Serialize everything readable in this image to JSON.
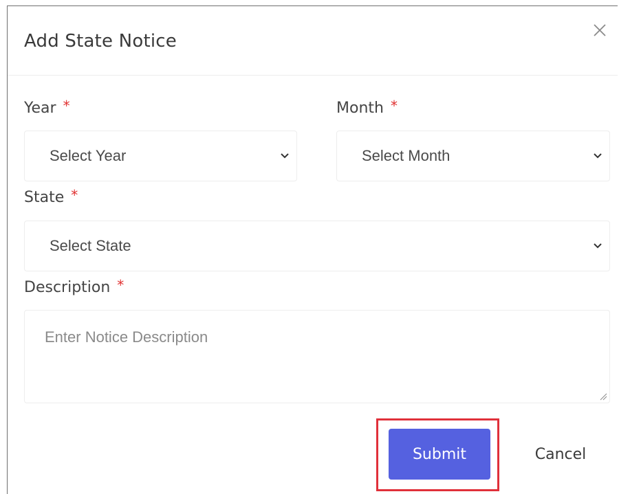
{
  "modal": {
    "title": "Add State Notice",
    "close_icon": "close-icon"
  },
  "form": {
    "required_mark": "*",
    "year": {
      "label": "Year",
      "selected": "Select Year"
    },
    "month": {
      "label": "Month",
      "selected": "Select Month"
    },
    "state": {
      "label": "State",
      "selected": "Select State"
    },
    "description": {
      "label": "Description",
      "placeholder": "Enter Notice Description"
    }
  },
  "actions": {
    "submit_label": "Submit",
    "cancel_label": "Cancel"
  },
  "colors": {
    "primary": "#5561e0",
    "required": "#e03131",
    "highlight": "#e0303a"
  }
}
